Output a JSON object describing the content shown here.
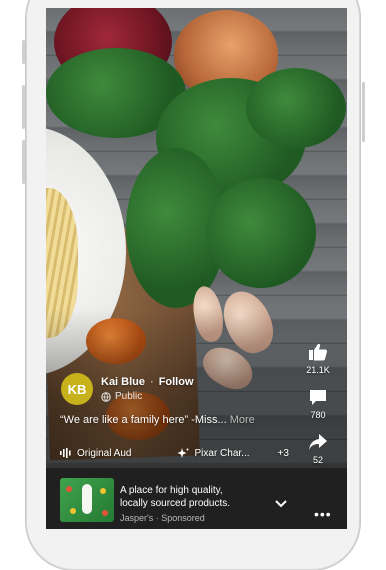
{
  "author": {
    "initials": "KB",
    "name": "Kai Blue",
    "follow_label": "Follow",
    "visibility": "Public"
  },
  "caption": {
    "text": "“We are like a family here” -Miss...",
    "more_label": "More"
  },
  "audio": {
    "original_label": "Original Aud",
    "effect_label": "Pixar Char...",
    "extra_count": "+3"
  },
  "actions": {
    "like_count": "21.1K",
    "comment_count": "780",
    "share_count": "52"
  },
  "promo": {
    "title_line1": "A place for high quality,",
    "title_line2": "locally sourced products.",
    "sponsor": "Jasper's · Sponsored"
  },
  "colors": {
    "avatar": "#c7b21c",
    "promo_bg": "#202020",
    "thumb": "#3fa34d"
  },
  "icons": [
    "globe-icon",
    "audio-wave-icon",
    "sparkle-icon",
    "thumbs-up-icon",
    "comment-icon",
    "share-icon",
    "chevron-down-icon",
    "more-dots-icon"
  ]
}
